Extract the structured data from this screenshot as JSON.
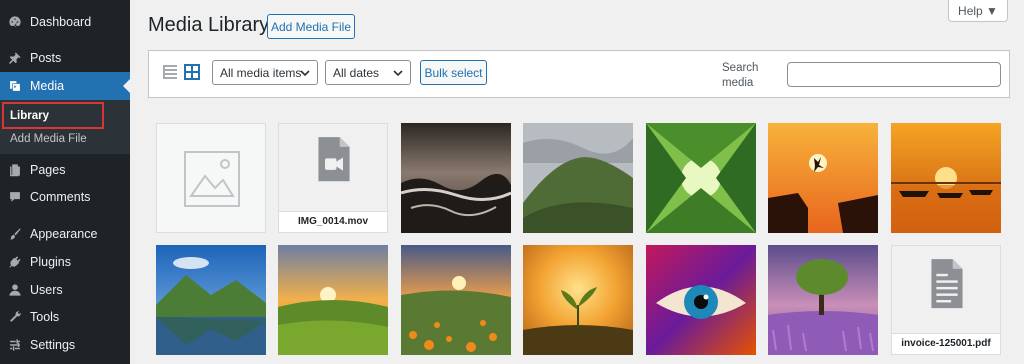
{
  "sidebar": {
    "items": [
      {
        "label": "Dashboard",
        "icon": "dashboard-icon"
      },
      {
        "label": "Posts",
        "icon": "pin-icon"
      },
      {
        "label": "Media",
        "icon": "media-icon"
      },
      {
        "label": "Pages",
        "icon": "pages-icon"
      },
      {
        "label": "Comments",
        "icon": "comment-icon"
      },
      {
        "label": "Appearance",
        "icon": "brush-icon"
      },
      {
        "label": "Plugins",
        "icon": "plug-icon"
      },
      {
        "label": "Users",
        "icon": "user-icon"
      },
      {
        "label": "Tools",
        "icon": "wrench-icon"
      },
      {
        "label": "Settings",
        "icon": "settings-icon"
      }
    ],
    "active": "Media",
    "submenu": [
      "Library",
      "Add Media File"
    ]
  },
  "header": {
    "title": "Media Library",
    "add_button": "Add Media File",
    "help": "Help ▼"
  },
  "toolbar": {
    "filter_type": "All media items",
    "filter_date": "All dates",
    "bulk_select": "Bulk select",
    "search_label": "Search media",
    "search_value": ""
  },
  "media": [
    {
      "kind": "placeholder"
    },
    {
      "kind": "video",
      "filename": "IMG_0014.mov"
    },
    {
      "kind": "image",
      "subject": "stormy-sea"
    },
    {
      "kind": "image",
      "subject": "green-hill"
    },
    {
      "kind": "image",
      "subject": "forest-canopy"
    },
    {
      "kind": "image",
      "subject": "cliff-jump-sunset"
    },
    {
      "kind": "image",
      "subject": "boats-sunset"
    },
    {
      "kind": "image",
      "subject": "mountain-lake"
    },
    {
      "kind": "image",
      "subject": "meadow-sunset"
    },
    {
      "kind": "image",
      "subject": "flower-field-sunset"
    },
    {
      "kind": "image",
      "subject": "sprout-sunset"
    },
    {
      "kind": "image",
      "subject": "colorful-eye"
    },
    {
      "kind": "image",
      "subject": "tree-lavender"
    },
    {
      "kind": "document",
      "filename": "invoice-125001.pdf"
    }
  ],
  "colors": {
    "sidebar_bg": "#1d2327",
    "accent": "#2271b1",
    "highlight_border": "#d63638"
  }
}
